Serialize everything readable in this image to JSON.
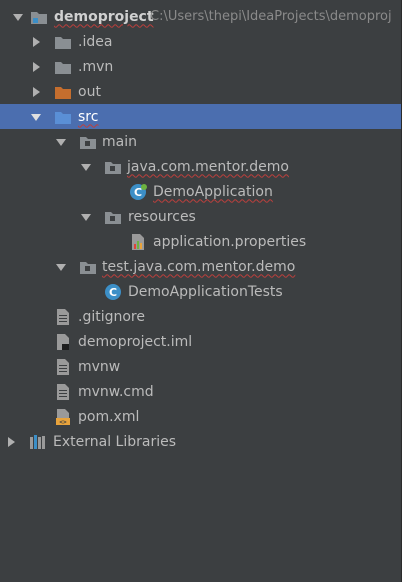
{
  "project": {
    "name": "demoproject",
    "path": "C:\\Users\\thepi\\IdeaProjects\\demoproj"
  },
  "items": {
    "idea": ".idea",
    "mvn": ".mvn",
    "out": "out",
    "src": "src",
    "main": "main",
    "java_pkg": "java.com.mentor.demo",
    "demo_app": "DemoApplication",
    "resources": "resources",
    "app_props": "application.properties",
    "test_pkg": "test.java.com.mentor.demo",
    "demo_tests": "DemoApplicationTests",
    "gitignore": ".gitignore",
    "iml": "demoproject.iml",
    "mvnw": "mvnw",
    "mvnw_cmd": "mvnw.cmd",
    "pom": "pom.xml",
    "ext_libs": "External Libraries"
  },
  "colors": {
    "background": "#3c3f41",
    "selection": "#4b6eaf",
    "folder": "#8a8f93",
    "out_folder": "#c56e2e",
    "src_folder": "#5a8fd6",
    "class_icon": "#3c8fc7"
  }
}
